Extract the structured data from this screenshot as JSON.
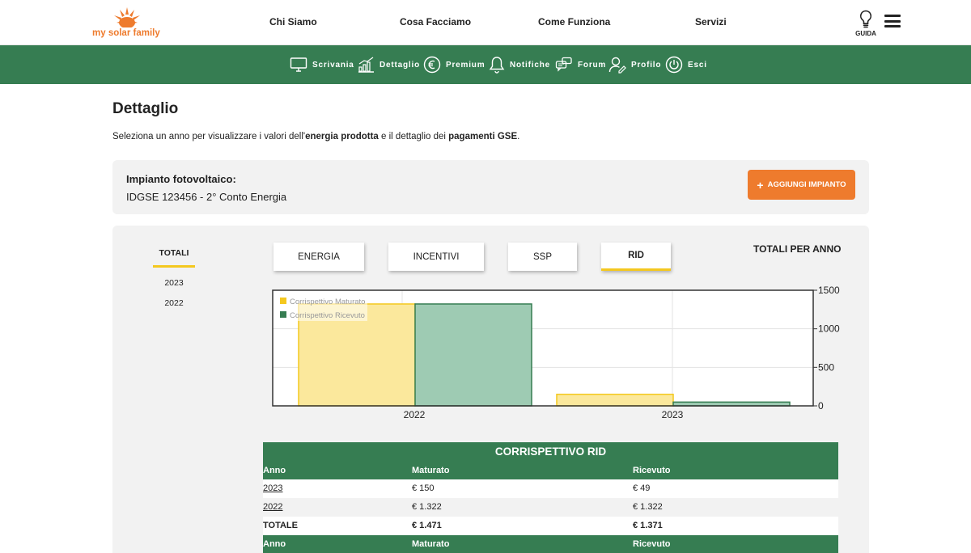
{
  "header": {
    "logo_text": "my solar family",
    "nav": [
      "Chi Siamo",
      "Cosa Facciamo",
      "Come Funziona",
      "Servizi"
    ],
    "guide_label": "GUIDA"
  },
  "subnav": {
    "items": [
      {
        "label": "Scrivania",
        "icon": "monitor-icon"
      },
      {
        "label": "Dettaglio",
        "icon": "bar-chart-icon"
      },
      {
        "label": "Premium",
        "icon": "euro-icon"
      },
      {
        "label": "Notifiche",
        "icon": "bell-icon"
      },
      {
        "label": "Forum",
        "icon": "chat-icon"
      },
      {
        "label": "Profilo",
        "icon": "user-icon"
      },
      {
        "label": "Esci",
        "icon": "power-icon"
      }
    ]
  },
  "page": {
    "title": "Dettaglio",
    "intro": {
      "pre": "Seleziona un anno per visualizzare i valori dell'",
      "bold1": "energia prodotta",
      "mid": " e il dettaglio dei ",
      "bold2": "pagamenti GSE",
      "post": "."
    }
  },
  "plant": {
    "label": "Impianto fotovoltaico:",
    "value": "IDGSE 123456 - 2° Conto Energia",
    "add_button": "AGGIUNGI IMPIANTO"
  },
  "year_tabs": [
    "TOTALI",
    "2023",
    "2022"
  ],
  "tabs": [
    "ENERGIA",
    "INCENTIVI",
    "SSP",
    "RID"
  ],
  "active_tab": "RID",
  "totals_heading": "TOTALI PER ANNO",
  "colors": {
    "brand_green": "#367d52",
    "brand_orange": "#ee7b2d",
    "accent_yellow": "#f4c81f",
    "maturato_fill": "#fbe89c",
    "ricevuto_fill": "#9ecbb3"
  },
  "chart_data": {
    "type": "bar",
    "categories": [
      "2022",
      "2023"
    ],
    "series": [
      {
        "name": "Corrispettivo Maturato",
        "values": [
          1322,
          150
        ]
      },
      {
        "name": "Corrispettivo Ricevuto",
        "values": [
          1322,
          49
        ]
      }
    ],
    "ylim": [
      0,
      1500
    ],
    "yticks": [
      "0",
      "500",
      "1000",
      "1500"
    ],
    "y_axis_side": "right",
    "legend_position": "top-left",
    "grid": true
  },
  "table": {
    "title": "CORRISPETTIVO RID",
    "headers": [
      "Anno",
      "Maturato",
      "Ricevuto"
    ],
    "rows": [
      [
        "2023",
        "€ 150",
        "€ 49"
      ],
      [
        "2022",
        "€ 1.322",
        "€ 1.322"
      ],
      [
        "TOTALE",
        "€ 1.471",
        "€ 1.371"
      ]
    ]
  }
}
